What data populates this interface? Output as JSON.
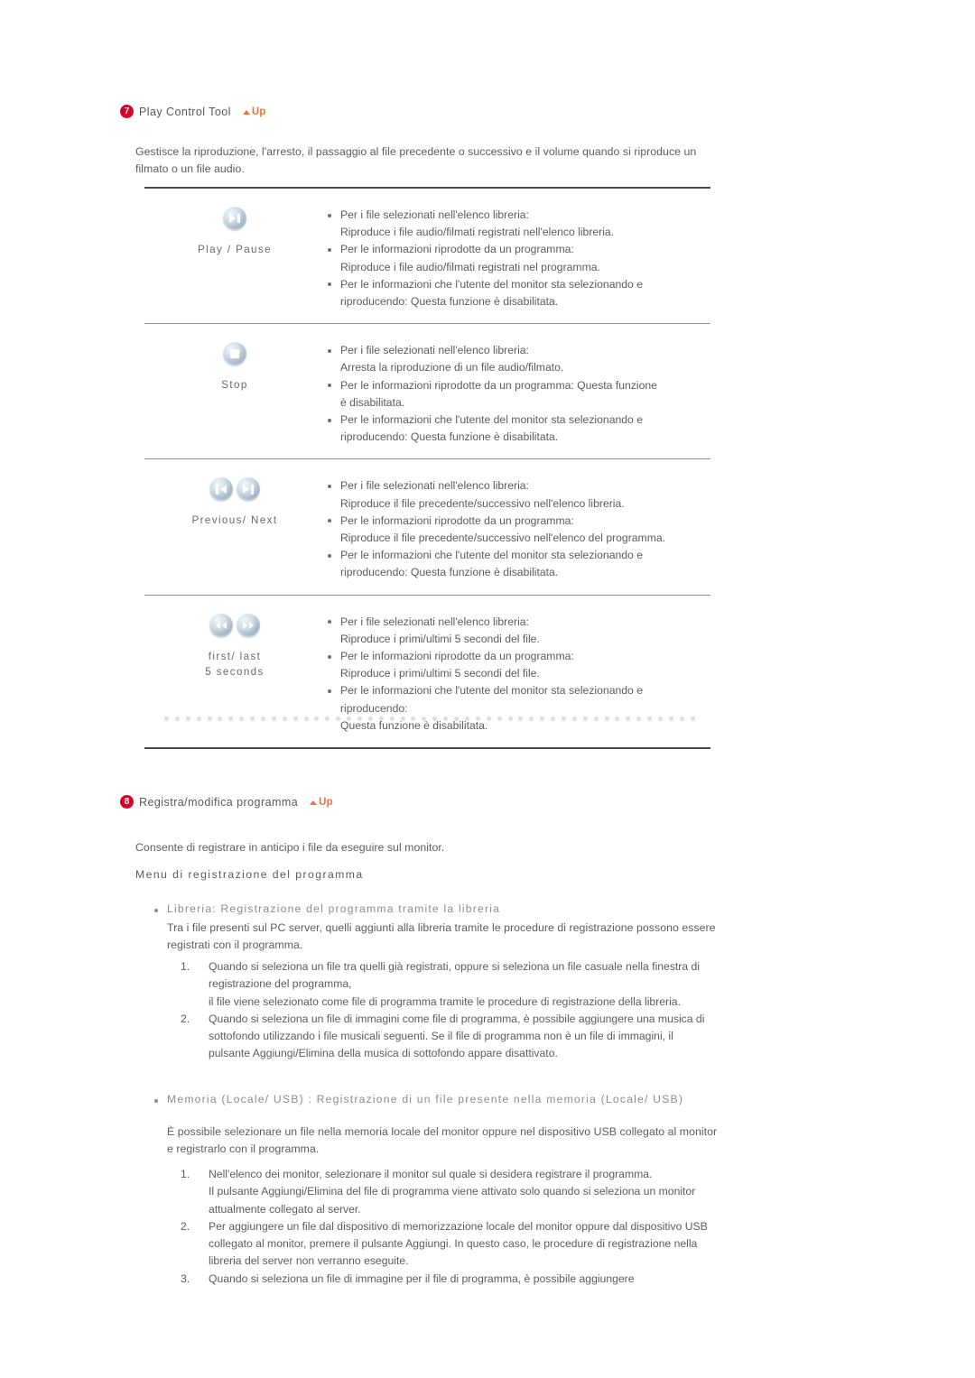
{
  "sections": [
    {
      "number": "7",
      "title": "Play Control Tool",
      "up_label": "Up",
      "intro": "Gestisce la riproduzione, l'arresto, il passaggio al file precedente o successivo e il volume quando si riproduce un filmato o un file audio."
    },
    {
      "number": "8",
      "title": "Registra/modifica programma",
      "up_label": "Up",
      "intro": "Consente di registrare in anticipo i file da eseguire sul monitor."
    }
  ],
  "control_table": {
    "rows": [
      {
        "icon": "play-pause-icon",
        "label": "Play / Pause",
        "label_lines": [
          "Play /  Pause"
        ],
        "items": [
          {
            "lead": "Per i file selezionati nell'elenco libreria:",
            "sub": "Riproduce i file audio/filmati registrati nell'elenco libreria."
          },
          {
            "lead": "Per le informazioni riprodotte da un programma:",
            "sub": "Riproduce i file audio/filmati registrati nel programma."
          },
          {
            "lead": "Per le informazioni che l'utente del monitor sta selezionando e",
            "sub": "riproducendo: Questa funzione è disabilitata."
          }
        ]
      },
      {
        "icon": "stop-icon",
        "label": "Stop",
        "label_lines": [
          "Stop"
        ],
        "items": [
          {
            "lead": "Per i file selezionati nell'elenco libreria:",
            "sub": "Arresta la riproduzione di un file audio/filmato."
          },
          {
            "lead": "Per le informazioni riprodotte da un programma: Questa funzione",
            "sub": "è disabilitata."
          },
          {
            "lead": "Per le informazioni che l'utente del monitor sta selezionando e",
            "sub": "riproducendo: Questa funzione è disabilitata."
          }
        ]
      },
      {
        "icon": "previous-next-icon",
        "label": "Previous/ Next",
        "label_lines": [
          "Previous/ Next"
        ],
        "items": [
          {
            "lead": "Per i file selezionati nell'elenco libreria:",
            "sub": "Riproduce il file precedente/successivo nell'elenco libreria."
          },
          {
            "lead": "Per le informazioni riprodotte da un programma:",
            "sub": "Riproduce il file precedente/successivo nell'elenco del programma."
          },
          {
            "lead": "Per le informazioni che l'utente del monitor sta selezionando e",
            "sub": "riproducendo: Questa funzione è disabilitata."
          }
        ]
      },
      {
        "icon": "first-last-5-seconds-icon",
        "label": "first/ last 5 seconds",
        "label_lines": [
          "first/ last",
          "5 seconds"
        ],
        "items": [
          {
            "lead": "Per i file selezionati nell'elenco libreria:",
            "sub": "Riproduce i primi/ultimi 5 secondi del file."
          },
          {
            "lead": "Per le informazioni riprodotte da un programma:",
            "sub": "Riproduce i primi/ultimi 5 secondi del file."
          },
          {
            "lead": "Per le informazioni che l'utente del monitor sta selezionando e",
            "sub": "riproducendo:",
            "sub2": "Questa funzione è disabilitata."
          }
        ]
      }
    ]
  },
  "program_section": {
    "menu_heading": "Menu di registrazione del programma",
    "library": {
      "heading": "Libreria: Registrazione del programma tramite la libreria",
      "body": "Tra i file presenti sul PC server, quelli aggiunti alla libreria tramite le procedure di registrazione possono essere registrati con il programma.",
      "items": [
        {
          "n": "1.",
          "lead": "Quando si seleziona un file tra quelli già registrati, oppure si seleziona un file casuale nella finestra di registrazione del programma,",
          "sub": "il file viene selezionato come file di programma tramite le procedure di registrazione della libreria."
        },
        {
          "n": "2.",
          "lead": "Quando si seleziona un file di immagini come file di programma, è possibile aggiungere una musica di sottofondo utilizzando i file musicali seguenti. Se il file di programma non è un file di immagini, il pulsante Aggiungi/Elimina della musica di sottofondo appare disattivato."
        }
      ]
    },
    "memory": {
      "heading": "Memoria (Locale/ USB) : Registrazione di un file presente nella memoria (Locale/ USB)",
      "body": "È possibile selezionare un file nella memoria locale del monitor oppure nel dispositivo USB collegato al monitor e registrarlo con il programma.",
      "items": [
        {
          "n": "1.",
          "lead": "Nell'elenco dei monitor, selezionare il monitor sul quale si desidera registrare il programma.",
          "sub": "Il pulsante Aggiungi/Elimina del file di programma viene attivato solo quando si seleziona un monitor attualmente collegato al server."
        },
        {
          "n": "2.",
          "lead": "Per aggiungere un file dal dispositivo di memorizzazione locale del monitor oppure dal dispositivo USB collegato al monitor, premere il pulsante Aggiungi. In questo caso, le procedure di registrazione nella libreria del server non verranno eseguite."
        },
        {
          "n": "3.",
          "lead": "Quando si seleziona un file di immagine per il file di programma, è possibile aggiungere"
        }
      ]
    }
  },
  "colors": {
    "badge": "#d80027",
    "up_link": "#e8743b",
    "text": "#5c5c5c",
    "heading_gray": "#8d8d8d",
    "rule_dark": "#4a4a4a",
    "rule_light": "#909090",
    "dot_divider": "#dedede"
  }
}
